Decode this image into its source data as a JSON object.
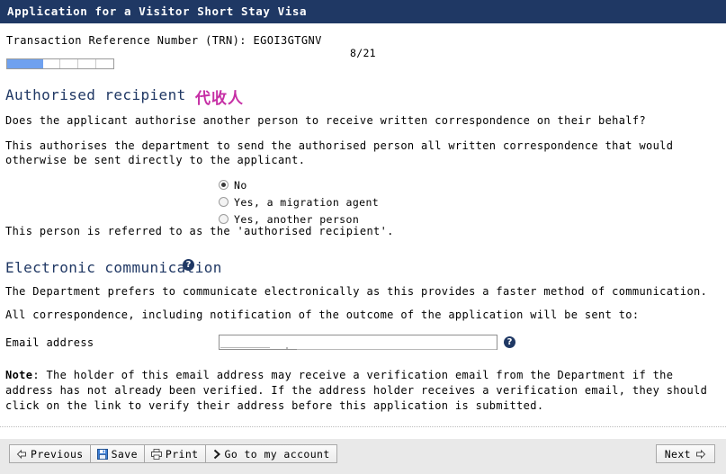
{
  "header": {
    "title": "Application for a Visitor Short Stay Visa"
  },
  "meta": {
    "trn_line": "Transaction Reference Number (TRN): EGOI3GTGNV",
    "page_counter": "8/21",
    "progress": {
      "total_cells": 6,
      "filled_cells": 2,
      "fill_color": "#6fa1ef"
    }
  },
  "sections": {
    "authorised_recipient": {
      "heading": "Authorised recipient",
      "heading_translation": "代收人",
      "heading_color": "#203864",
      "translation_color": "#c62fa5",
      "question": "Does the applicant authorise another person to receive written correspondence on their behalf?",
      "explanation": "This authorises the department to send the authorised person all written correspondence that would otherwise be sent directly to the applicant.",
      "options": [
        {
          "label": "No",
          "checked": true
        },
        {
          "label": "Yes, a migration agent",
          "checked": false
        },
        {
          "label": "Yes, another person",
          "checked": false
        }
      ],
      "footnote": "This person is referred to as the 'authorised recipient'."
    },
    "electronic_communication": {
      "heading": "Electronic communication",
      "help_icon": "help-question-icon",
      "paragraph_1": "The Department prefers to communicate electronically as this provides a faster method of communication.",
      "paragraph_2": "All correspondence, including notification of the outcome of the application will be sent to:",
      "email_field": {
        "label": "Email address",
        "value": "",
        "placeholder": "",
        "help_icon": "help-question-icon"
      },
      "note_label": "Note",
      "note_text": ": The holder of this email address may receive a verification email from the Department if the address has not already been verified. If the address holder receives a verification email, they should click on the link to verify their address before this application is submitted."
    }
  },
  "footer": {
    "buttons": [
      {
        "label": "Previous",
        "icon": "arrow-left-icon"
      },
      {
        "label": "Save",
        "icon": "floppy-disk-icon"
      },
      {
        "label": "Print",
        "icon": "printer-icon"
      },
      {
        "label": "Go to my account",
        "icon": "chevron-right-icon"
      }
    ],
    "next_button": {
      "label": "Next",
      "icon": "arrow-right-icon"
    }
  }
}
